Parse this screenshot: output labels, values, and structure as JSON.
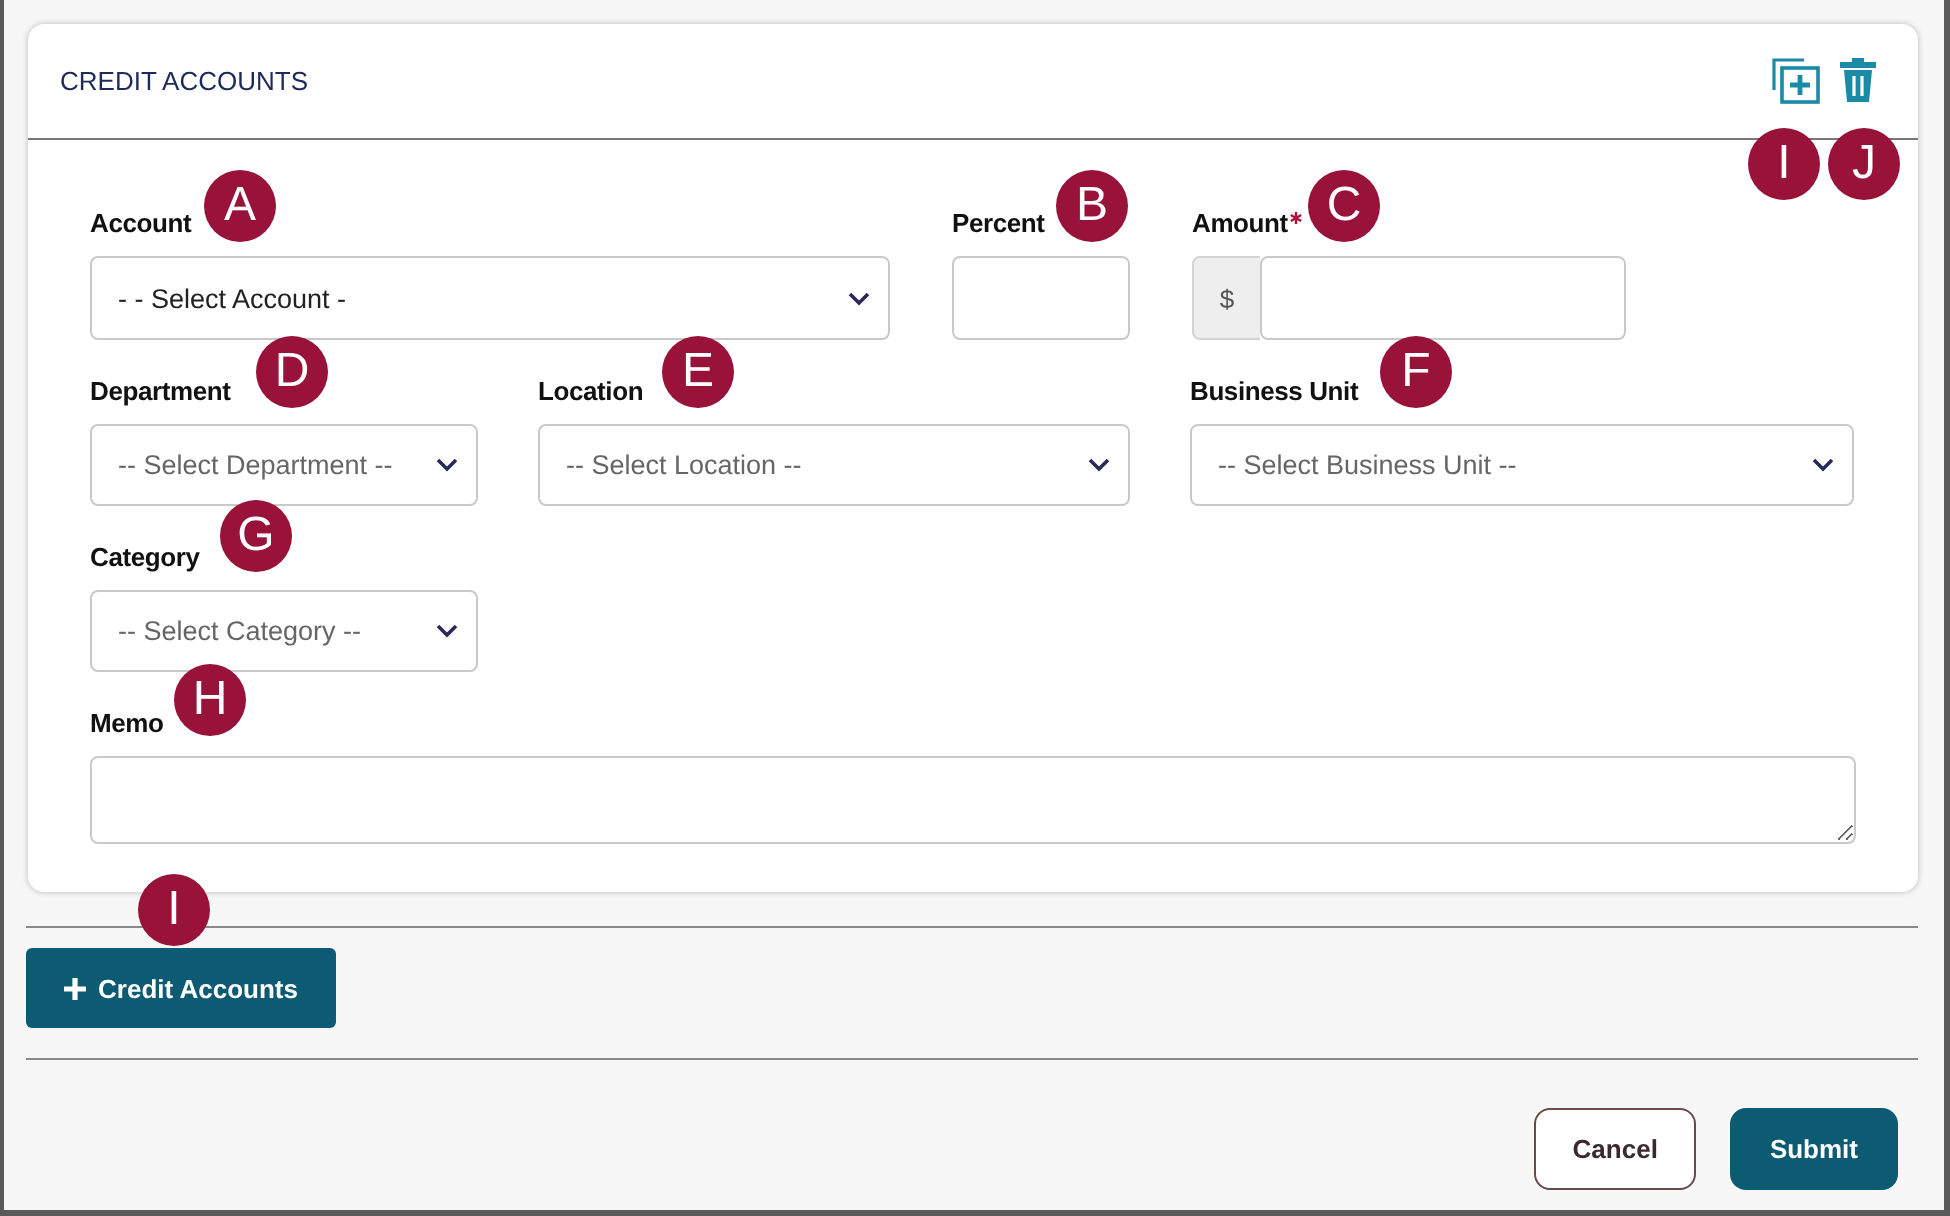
{
  "card": {
    "title": "CREDIT ACCOUNTS",
    "actions": [
      {
        "kind": "duplicate"
      },
      {
        "kind": "delete"
      }
    ]
  },
  "rows": [
    {
      "fields": [
        {
          "label": "Account",
          "kind": "select",
          "value": "- - Select Account -",
          "required": false
        },
        {
          "label": "Percent",
          "kind": "input",
          "required": false
        },
        {
          "label": "Amount",
          "kind": "currency",
          "prefix": "$",
          "required": true
        }
      ]
    },
    {
      "fields": [
        {
          "label": "Department",
          "kind": "select",
          "value": "-- Select Department --",
          "required": false
        },
        {
          "label": "Location",
          "kind": "select",
          "value": "-- Select Location --",
          "required": false
        },
        {
          "label": "Business Unit",
          "kind": "select",
          "value": "-- Select Business Unit --",
          "required": false
        }
      ]
    },
    {
      "fields": [
        {
          "label": "Category",
          "kind": "select",
          "value": "-- Select Category --",
          "required": false
        }
      ]
    },
    {
      "fields": [
        {
          "label": "Memo",
          "kind": "textarea",
          "required": false
        }
      ]
    }
  ],
  "add_button": {
    "label": "Credit Accounts"
  },
  "footer_buttons": [
    {
      "label": "Cancel",
      "kind": "secondary"
    },
    {
      "label": "Submit",
      "kind": "primary"
    }
  ],
  "callouts": [
    {
      "letter": "A"
    },
    {
      "letter": "B"
    },
    {
      "letter": "C"
    },
    {
      "letter": "D"
    },
    {
      "letter": "E"
    },
    {
      "letter": "F"
    },
    {
      "letter": "G"
    },
    {
      "letter": "H"
    },
    {
      "letter": "I"
    },
    {
      "letter": "I"
    },
    {
      "letter": "J"
    }
  ]
}
